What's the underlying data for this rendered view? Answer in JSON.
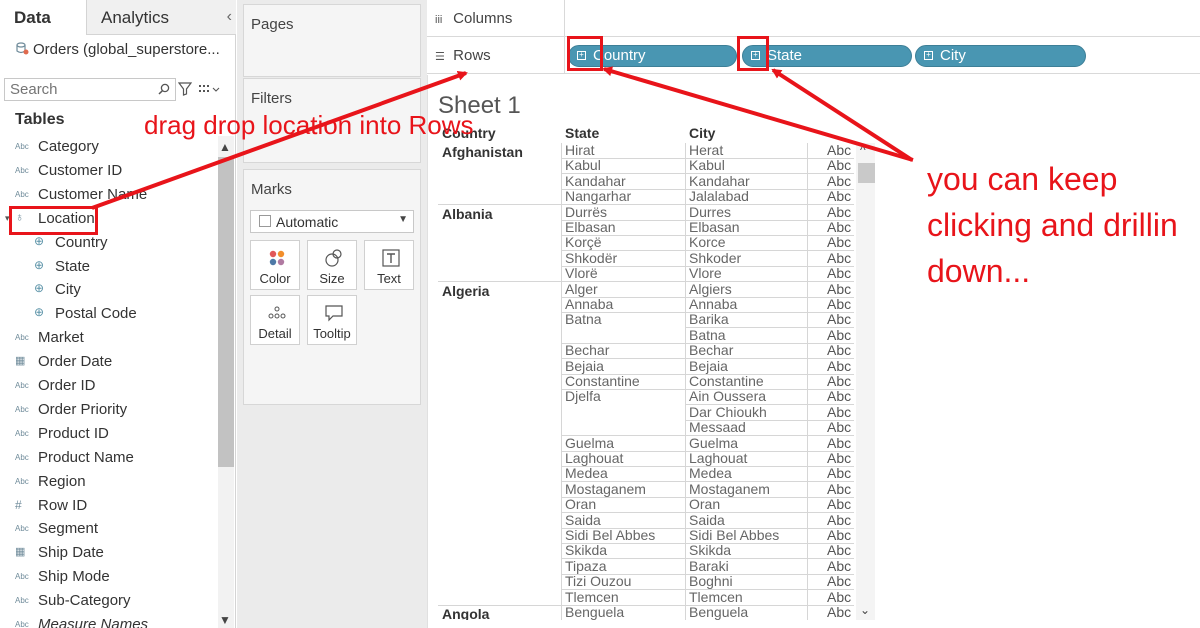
{
  "left_pane": {
    "tabs": [
      "Data",
      "Analytics"
    ],
    "collapse": "‹",
    "datasource": "Orders (global_superstore...",
    "search_placeholder": "Search",
    "tables_heading": "Tables",
    "fields": [
      {
        "type": "Abc",
        "label": "Category"
      },
      {
        "type": "Abc",
        "label": "Customer ID"
      },
      {
        "type": "Abc",
        "label": "Customer Name"
      },
      {
        "type": "hier",
        "label": "Location"
      },
      {
        "type": "geo",
        "label": "Country",
        "child": true
      },
      {
        "type": "geo",
        "label": "State",
        "child": true
      },
      {
        "type": "geo",
        "label": "City",
        "child": true
      },
      {
        "type": "geo",
        "label": "Postal Code",
        "child": true
      },
      {
        "type": "Abc",
        "label": "Market"
      },
      {
        "type": "date",
        "label": "Order Date"
      },
      {
        "type": "Abc",
        "label": "Order ID"
      },
      {
        "type": "Abc",
        "label": "Order Priority"
      },
      {
        "type": "Abc",
        "label": "Product ID"
      },
      {
        "type": "Abc",
        "label": "Product Name"
      },
      {
        "type": "Abc",
        "label": "Region"
      },
      {
        "type": "#",
        "label": "Row ID"
      },
      {
        "type": "Abc",
        "label": "Segment"
      },
      {
        "type": "date",
        "label": "Ship Date"
      },
      {
        "type": "Abc",
        "label": "Ship Mode"
      },
      {
        "type": "Abc",
        "label": "Sub-Category"
      },
      {
        "type": "Abc",
        "label": "Measure Names",
        "italic": true
      }
    ]
  },
  "cards": {
    "pages": "Pages",
    "filters": "Filters",
    "marks": "Marks",
    "mark_type": "Automatic",
    "mark_buttons": [
      "Color",
      "Size",
      "Text",
      "Detail",
      "Tooltip"
    ]
  },
  "shelves": {
    "columns_label": "Columns",
    "rows_label": "Rows",
    "row_pills": [
      "Country",
      "State",
      "City"
    ]
  },
  "view": {
    "sheet_title": "Sheet 1",
    "headers": [
      "Country",
      "State",
      "City"
    ],
    "groups": [
      {
        "country": "Afghanistan",
        "rows": [
          [
            "Hirat",
            "Herat"
          ],
          [
            "Kabul",
            "Kabul"
          ],
          [
            "Kandahar",
            "Kandahar"
          ],
          [
            "Nangarhar",
            "Jalalabad"
          ]
        ]
      },
      {
        "country": "Albania",
        "rows": [
          [
            "Durrës",
            "Durres"
          ],
          [
            "Elbasan",
            "Elbasan"
          ],
          [
            "Korçë",
            "Korce"
          ],
          [
            "Shkodër",
            "Shkoder"
          ],
          [
            "Vlorë",
            "Vlore"
          ]
        ]
      },
      {
        "country": "Algeria",
        "rows": [
          [
            "Alger",
            "Algiers"
          ],
          [
            "Annaba",
            "Annaba"
          ],
          [
            "Batna",
            "Barika"
          ],
          [
            "",
            "Batna"
          ],
          [
            "Bechar",
            "Bechar"
          ],
          [
            "Bejaia",
            "Bejaia"
          ],
          [
            "Constantine",
            "Constantine"
          ],
          [
            "Djelfa",
            "Ain Oussera"
          ],
          [
            "",
            "Dar Chioukh"
          ],
          [
            "",
            "Messaad"
          ],
          [
            "Guelma",
            "Guelma"
          ],
          [
            "Laghouat",
            "Laghouat"
          ],
          [
            "Medea",
            "Medea"
          ],
          [
            "Mostaganem",
            "Mostaganem"
          ],
          [
            "Oran",
            "Oran"
          ],
          [
            "Saida",
            "Saida"
          ],
          [
            "Sidi Bel Abbes",
            "Sidi Bel Abbes"
          ],
          [
            "Skikda",
            "Skikda"
          ],
          [
            "Tipaza",
            "Baraki"
          ],
          [
            "Tizi Ouzou",
            "Boghni"
          ],
          [
            "Tlemcen",
            "Tlemcen"
          ]
        ]
      },
      {
        "country": "Angola",
        "rows": [
          [
            "Benguela",
            "Benguela"
          ]
        ]
      }
    ],
    "abc": "Abc"
  },
  "annotations": {
    "drag": "drag drop location into Rows",
    "keep_lines": [
      "you can keep",
      "clicking and drillin",
      "down..."
    ]
  },
  "colors": {
    "pill": "#4996b2",
    "annotation": "#e8141a"
  }
}
